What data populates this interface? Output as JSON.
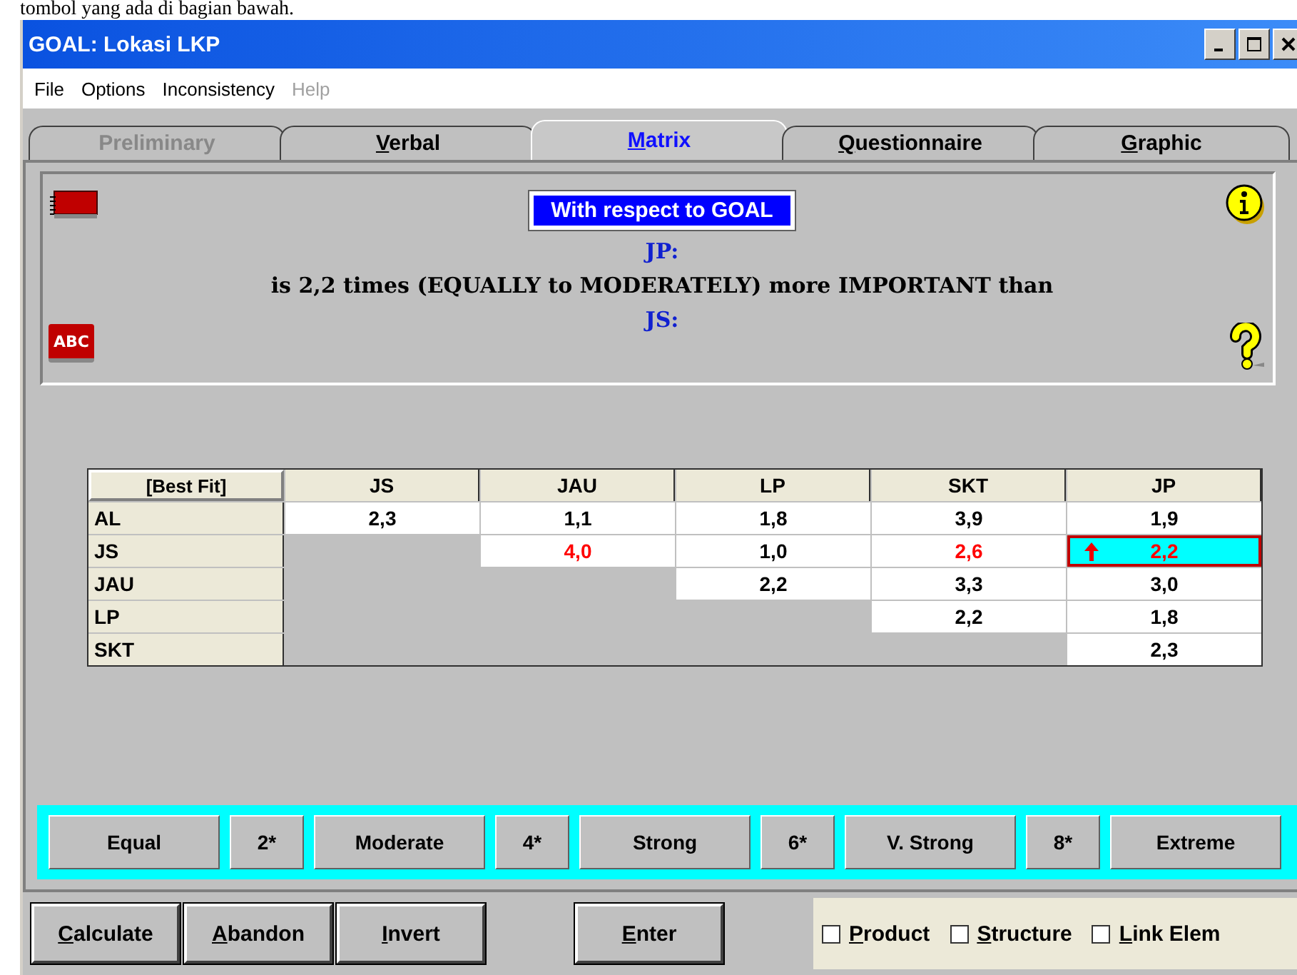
{
  "document_text": "tombol yang ada di bagian bawah.",
  "window": {
    "title": "GOAL: Lokasi LKP"
  },
  "menu": [
    {
      "label": "File",
      "disabled": false
    },
    {
      "label": "Options",
      "disabled": false
    },
    {
      "label": "Inconsistency",
      "disabled": false
    },
    {
      "label": "Help",
      "disabled": true
    }
  ],
  "tabs": [
    {
      "label": "Preliminary",
      "selected": false,
      "disabled": true,
      "mnemonic": false
    },
    {
      "label": "Verbal",
      "selected": false,
      "disabled": false,
      "mnemonic": true
    },
    {
      "label": "Matrix",
      "selected": true,
      "disabled": false,
      "mnemonic": true
    },
    {
      "label": "Questionnaire",
      "selected": false,
      "disabled": false,
      "mnemonic": true
    },
    {
      "label": "Graphic",
      "selected": false,
      "disabled": false,
      "mnemonic": true
    }
  ],
  "info_panel": {
    "abc_icon_label": "ABC",
    "heading": "With respect to GOAL",
    "first_item": "JP:",
    "statement": "is 2,2 times (EQUALLY to MODERATELY) more IMPORTANT than",
    "second_item": "JS:"
  },
  "matrix": {
    "corner": "[Best Fit]",
    "columns": [
      "JS",
      "JAU",
      "LP",
      "SKT",
      "JP"
    ],
    "rows": [
      {
        "label": "AL",
        "cells": [
          {
            "kind": "value",
            "value": "2,3",
            "inconsistent": false,
            "selected": false
          },
          {
            "kind": "value",
            "value": "1,1",
            "inconsistent": false,
            "selected": false
          },
          {
            "kind": "value",
            "value": "1,8",
            "inconsistent": false,
            "selected": false
          },
          {
            "kind": "value",
            "value": "3,9",
            "inconsistent": false,
            "selected": false
          },
          {
            "kind": "value",
            "value": "1,9",
            "inconsistent": false,
            "selected": false
          }
        ]
      },
      {
        "label": "JS",
        "cells": [
          {
            "kind": "empty"
          },
          {
            "kind": "value",
            "value": "4,0",
            "inconsistent": true,
            "selected": false
          },
          {
            "kind": "value",
            "value": "1,0",
            "inconsistent": false,
            "selected": false
          },
          {
            "kind": "value",
            "value": "2,6",
            "inconsistent": true,
            "selected": false
          },
          {
            "kind": "value",
            "value": "2,2",
            "inconsistent": true,
            "selected": true
          }
        ]
      },
      {
        "label": "JAU",
        "cells": [
          {
            "kind": "empty"
          },
          {
            "kind": "empty"
          },
          {
            "kind": "value",
            "value": "2,2",
            "inconsistent": false,
            "selected": false
          },
          {
            "kind": "value",
            "value": "3,3",
            "inconsistent": false,
            "selected": false
          },
          {
            "kind": "value",
            "value": "3,0",
            "inconsistent": false,
            "selected": false
          }
        ]
      },
      {
        "label": "LP",
        "cells": [
          {
            "kind": "empty"
          },
          {
            "kind": "empty"
          },
          {
            "kind": "empty"
          },
          {
            "kind": "value",
            "value": "2,2",
            "inconsistent": false,
            "selected": false
          },
          {
            "kind": "value",
            "value": "1,8",
            "inconsistent": false,
            "selected": false
          }
        ]
      },
      {
        "label": "SKT",
        "cells": [
          {
            "kind": "empty"
          },
          {
            "kind": "empty"
          },
          {
            "kind": "empty"
          },
          {
            "kind": "empty"
          },
          {
            "kind": "value",
            "value": "2,3",
            "inconsistent": false,
            "selected": false
          }
        ]
      }
    ]
  },
  "scale_buttons": [
    {
      "label": "Equal",
      "kind": "wide"
    },
    {
      "label": "2*",
      "kind": "narrow"
    },
    {
      "label": "Moderate",
      "kind": "wide"
    },
    {
      "label": "4*",
      "kind": "narrow"
    },
    {
      "label": "Strong",
      "kind": "wide"
    },
    {
      "label": "6*",
      "kind": "narrow"
    },
    {
      "label": "V. Strong",
      "kind": "wide"
    },
    {
      "label": "8*",
      "kind": "narrow"
    },
    {
      "label": "Extreme",
      "kind": "wide"
    }
  ],
  "action_buttons": [
    {
      "label": "Calculate",
      "mnemonic": true
    },
    {
      "label": "Abandon",
      "mnemonic": true
    },
    {
      "label": "Invert",
      "mnemonic": true
    },
    {
      "label": "Enter",
      "mnemonic": true
    }
  ],
  "options": [
    {
      "label": "Product",
      "checked": false,
      "mnemonic": true
    },
    {
      "label": "Structure",
      "checked": false,
      "mnemonic": true
    },
    {
      "label": "Link Elem",
      "checked": false,
      "mnemonic": true
    }
  ]
}
